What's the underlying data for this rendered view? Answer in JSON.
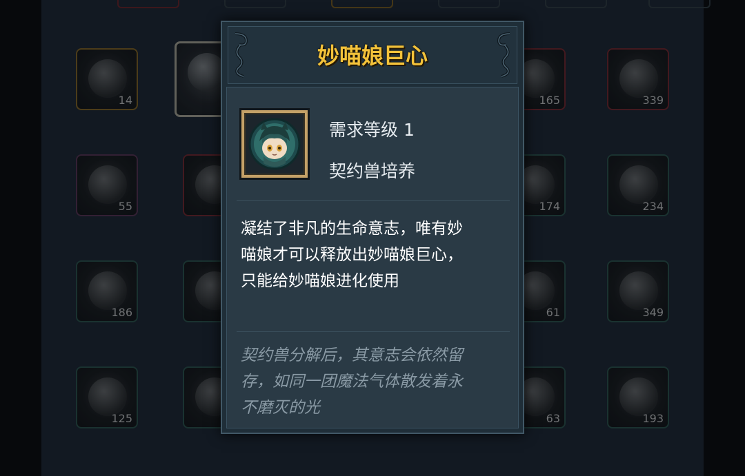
{
  "tooltip": {
    "title": "妙喵娘巨心",
    "required_level": "需求等级 1",
    "category": "契约兽培养",
    "description": [
      "凝结了非凡的生命意志，唯有妙",
      "喵娘才可以释放出妙喵娘巨心，",
      "只能给妙喵娘进化使用"
    ],
    "flavor": [
      "契约兽分解后，其意志会依然留",
      "存，如同一团魔法气体散发着永",
      "不磨灭的光"
    ],
    "item_icon": "cat-girl-portrait-icon"
  },
  "inventory": {
    "counts": {
      "r1c1": "14",
      "r1c5": "165",
      "r1c6": "339",
      "r2c1": "55",
      "r2c5": "174",
      "r2c6": "234",
      "r3c1": "186",
      "r3c5": "61",
      "r3c6": "349",
      "r4c1": "125",
      "r4c5": "63",
      "r4c6": "193"
    }
  },
  "colors": {
    "title": "#f3c23a",
    "panel": "#1f2e38",
    "text": "#e7ecf0",
    "flavor": "#8a9aa5"
  }
}
